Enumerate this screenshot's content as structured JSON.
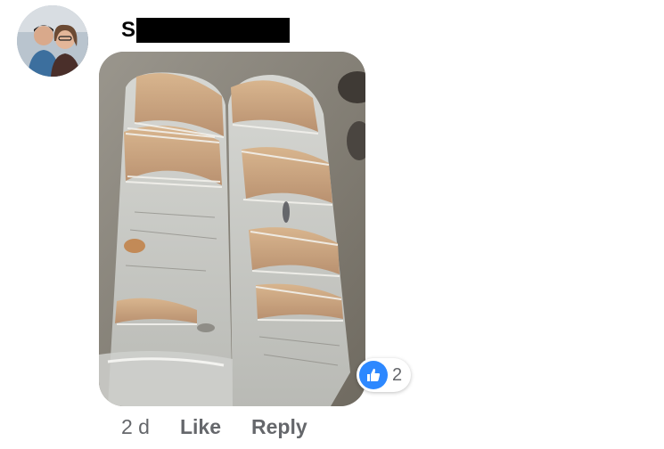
{
  "comment": {
    "author_initial": "S",
    "author_redacted": true,
    "avatar_icon": "profile-photo-icon",
    "photo_description_icon": "photo-icon",
    "reaction": {
      "icon": "thumbs-up-icon",
      "count": "2",
      "color": "#2d88ff"
    },
    "meta": {
      "time": "2 d",
      "like_label": "Like",
      "reply_label": "Reply"
    }
  }
}
